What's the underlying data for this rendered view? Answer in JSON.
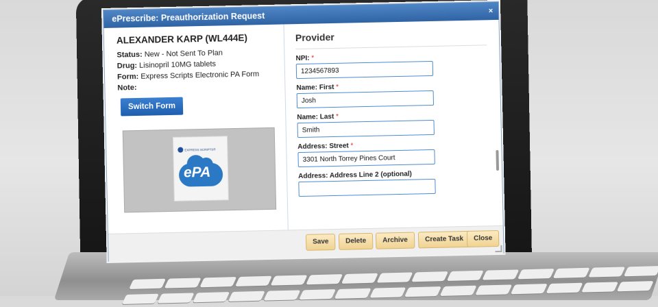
{
  "dialog": {
    "title": "ePrescribe: Preauthorization Request",
    "close_glyph": "×"
  },
  "patient": {
    "name": "ALEXANDER KARP (WL444E)",
    "status_label": "Status:",
    "status_value": "New - Not Sent To Plan",
    "drug_label": "Drug:",
    "drug_value": "Lisinopril 10MG tablets",
    "form_label": "Form:",
    "form_value": "Express Scripts Electronic PA Form",
    "note_label": "Note:",
    "switch_form": "Switch Form"
  },
  "preview": {
    "brand": "EXPRESS SCRIPTS®",
    "logo_text": "ePA"
  },
  "provider": {
    "title": "Provider",
    "required_mark": "*",
    "fields": [
      {
        "label": "NPI:",
        "value": "1234567893",
        "required": true
      },
      {
        "label": "Name: First",
        "value": "Josh",
        "required": true
      },
      {
        "label": "Name: Last",
        "value": "Smith",
        "required": true
      },
      {
        "label": "Address: Street",
        "value": "3301 North Torrey Pines Court",
        "required": true
      },
      {
        "label": "Address: Address Line 2 (optional)",
        "value": "",
        "required": false
      }
    ]
  },
  "footer": {
    "save": "Save",
    "delete": "Delete",
    "archive": "Archive",
    "create_task": "Create Task",
    "close": "Close"
  },
  "colors": {
    "titlebar": "#2f63a4",
    "primary_button": "#1e5eae",
    "action_button": "#f0d394",
    "required": "#dd2222"
  }
}
